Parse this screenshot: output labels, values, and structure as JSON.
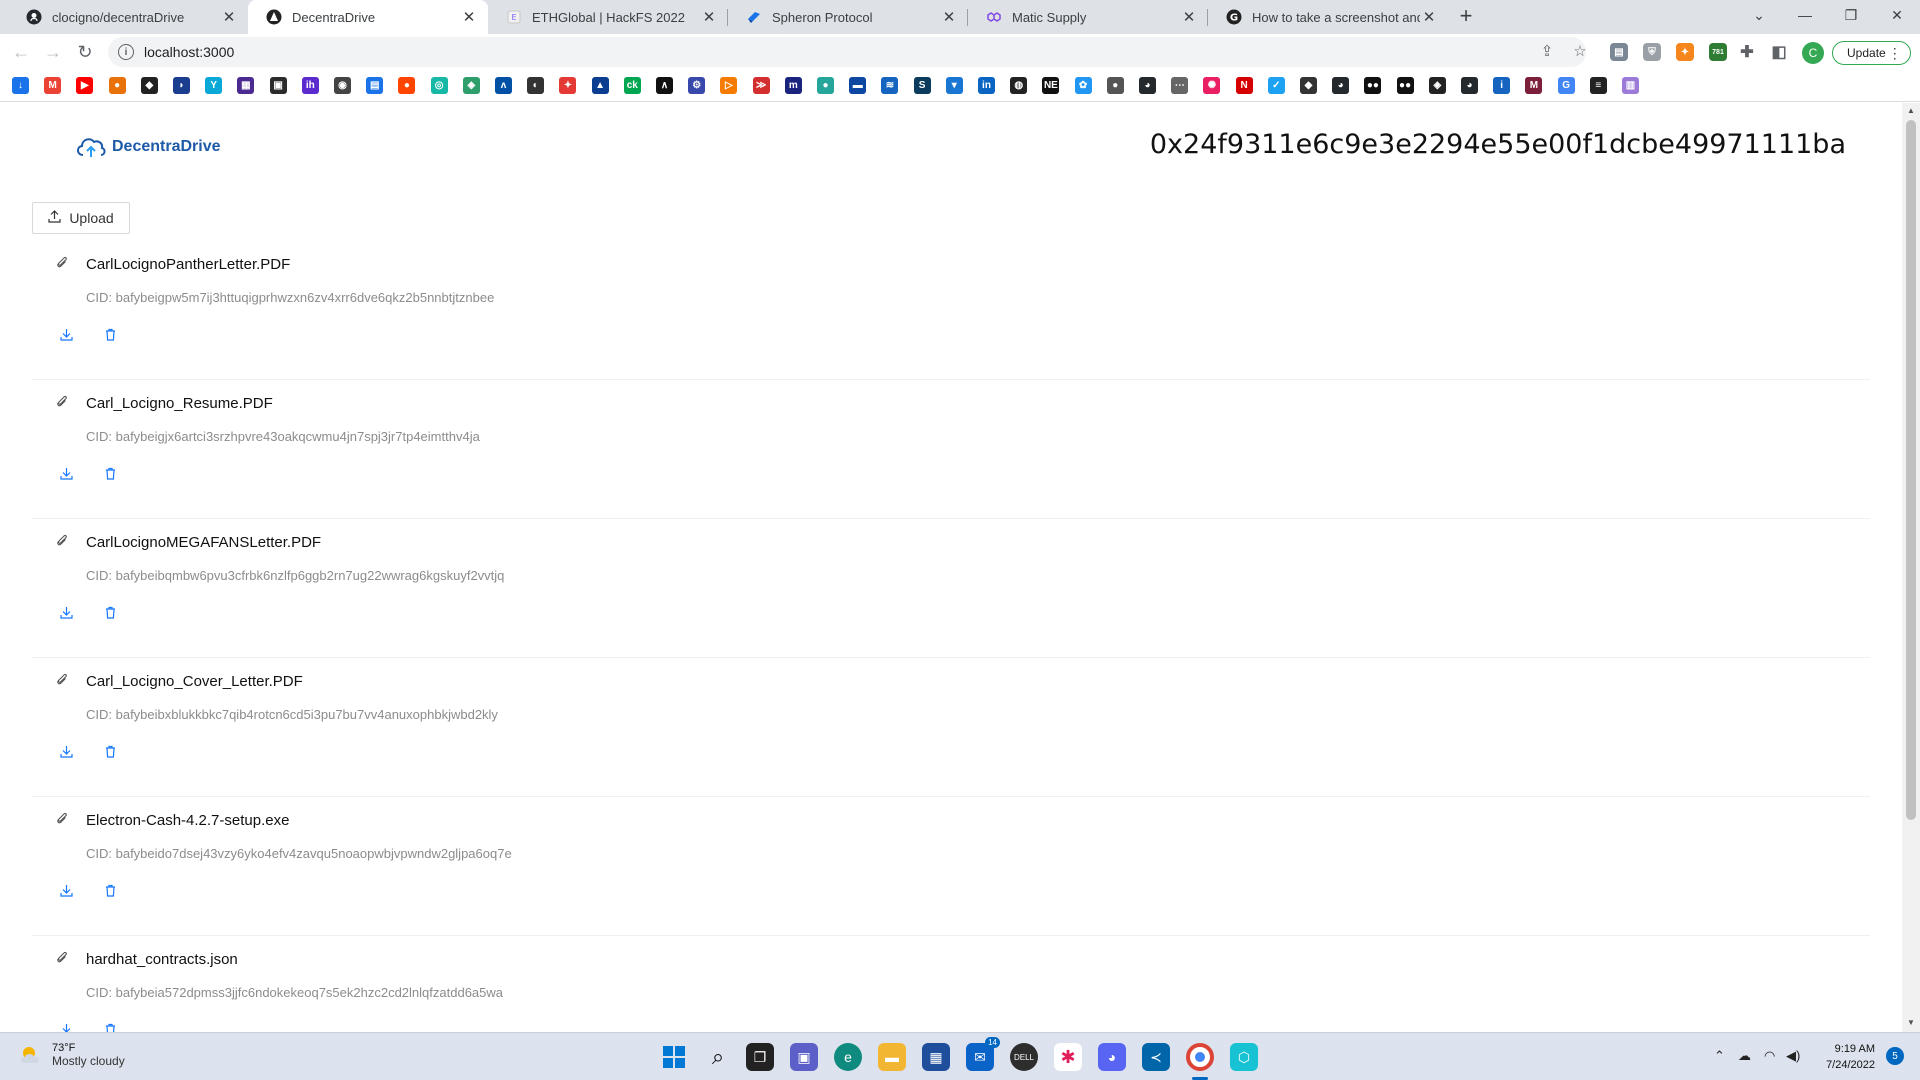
{
  "browser": {
    "tabs": [
      {
        "title": "clocigno/decentraDrive",
        "icon": "github-icon"
      },
      {
        "title": "DecentraDrive",
        "icon": "decentradrive-favicon-icon"
      },
      {
        "title": "ETHGlobal | HackFS 2022",
        "icon": "ethglobal-favicon-icon"
      },
      {
        "title": "Spheron Protocol",
        "icon": "spheron-favicon-icon"
      },
      {
        "title": "Matic Supply",
        "icon": "matic-favicon-icon"
      },
      {
        "title": "How to take a screenshot and sa",
        "icon": "google-favicon-icon"
      }
    ],
    "url": "localhost:3000",
    "update_label": "Update",
    "profile_initial": "C",
    "extension_badge": "781"
  },
  "bookmarks": [
    {
      "icon": "download-bookmark-icon",
      "color": "#1a73e8",
      "glyph": "↓"
    },
    {
      "icon": "gmail-icon",
      "color": "#ea4335",
      "glyph": "M"
    },
    {
      "icon": "youtube-icon",
      "color": "#ff0000",
      "glyph": "▶"
    },
    {
      "icon": "bookmark-icon",
      "color": "#e8710a",
      "glyph": "●"
    },
    {
      "icon": "bookmark-icon",
      "color": "#222222",
      "glyph": "◆"
    },
    {
      "icon": "bookmark-icon",
      "color": "#1a3d8f",
      "glyph": "◗"
    },
    {
      "icon": "bookmark-icon",
      "color": "#0aa8d6",
      "glyph": "Y"
    },
    {
      "icon": "bookmark-icon",
      "color": "#4b2a91",
      "glyph": "▦"
    },
    {
      "icon": "bookmark-icon",
      "color": "#2b2b2b",
      "glyph": "▣"
    },
    {
      "icon": "bookmark-icon",
      "color": "#5b2bcf",
      "glyph": "ih"
    },
    {
      "icon": "bookmark-icon",
      "color": "#444444",
      "glyph": "◉"
    },
    {
      "icon": "bookmark-icon",
      "color": "#1a73e8",
      "glyph": "▤"
    },
    {
      "icon": "reddit-icon",
      "color": "#ff4500",
      "glyph": "●"
    },
    {
      "icon": "bookmark-icon",
      "color": "#17b8a6",
      "glyph": "◎"
    },
    {
      "icon": "bookmark-icon",
      "color": "#2e9e6b",
      "glyph": "◈"
    },
    {
      "icon": "bookmark-icon",
      "color": "#0051a5",
      "glyph": "ʌ"
    },
    {
      "icon": "bookmark-icon",
      "color": "#333333",
      "glyph": "◐"
    },
    {
      "icon": "bookmark-icon",
      "color": "#e53935",
      "glyph": "✦"
    },
    {
      "icon": "bookmark-icon",
      "color": "#0b3d91",
      "glyph": "▲"
    },
    {
      "icon": "bookmark-icon",
      "color": "#00a650",
      "glyph": "ck"
    },
    {
      "icon": "bookmark-icon",
      "color": "#111111",
      "glyph": "∧"
    },
    {
      "icon": "bookmark-icon",
      "color": "#3949ab",
      "glyph": "⚙"
    },
    {
      "icon": "bookmark-icon",
      "color": "#f57c00",
      "glyph": "▷"
    },
    {
      "icon": "bookmark-icon",
      "color": "#d32f2f",
      "glyph": "≫"
    },
    {
      "icon": "bookmark-icon",
      "color": "#1a237e",
      "glyph": "m"
    },
    {
      "icon": "bookmark-icon",
      "color": "#26a69a",
      "glyph": "●"
    },
    {
      "icon": "bookmark-icon",
      "color": "#0d47a1",
      "glyph": "▬"
    },
    {
      "icon": "bookmark-icon",
      "color": "#1565c0",
      "glyph": "≋"
    },
    {
      "icon": "bookmark-icon",
      "color": "#0b3c5d",
      "glyph": "S"
    },
    {
      "icon": "bookmark-icon",
      "color": "#1976d2",
      "glyph": "▾"
    },
    {
      "icon": "linkedin-icon",
      "color": "#0a66c2",
      "glyph": "in"
    },
    {
      "icon": "bookmark-icon",
      "color": "#222222",
      "glyph": "◍"
    },
    {
      "icon": "bookmark-icon",
      "color": "#111111",
      "glyph": "NE"
    },
    {
      "icon": "bookmark-icon",
      "color": "#2196f3",
      "glyph": "✿"
    },
    {
      "icon": "bookmark-icon",
      "color": "#555555",
      "glyph": "●"
    },
    {
      "icon": "github-icon",
      "color": "#24292e",
      "glyph": "◕"
    },
    {
      "icon": "bookmark-icon",
      "color": "#666666",
      "glyph": "⋯"
    },
    {
      "icon": "bookmark-icon",
      "color": "#e91e63",
      "glyph": "✺"
    },
    {
      "icon": "bookmark-icon",
      "color": "#d50000",
      "glyph": "N"
    },
    {
      "icon": "twitter-icon",
      "color": "#1da1f2",
      "glyph": "✓"
    },
    {
      "icon": "bookmark-icon",
      "color": "#333333",
      "glyph": "◆"
    },
    {
      "icon": "github-icon",
      "color": "#24292e",
      "glyph": "◕"
    },
    {
      "icon": "bookmark-icon",
      "color": "#111111",
      "glyph": "●●"
    },
    {
      "icon": "bookmark-icon",
      "color": "#111111",
      "glyph": "●●"
    },
    {
      "icon": "bookmark-icon",
      "color": "#222222",
      "glyph": "◈"
    },
    {
      "icon": "github-icon",
      "color": "#24292e",
      "glyph": "◕"
    },
    {
      "icon": "bookmark-icon",
      "color": "#1565c0",
      "glyph": "i"
    },
    {
      "icon": "bookmark-icon",
      "color": "#7b1f3a",
      "glyph": "M"
    },
    {
      "icon": "google-icon",
      "color": "#4285f4",
      "glyph": "G"
    },
    {
      "icon": "bookmark-icon",
      "color": "#222222",
      "glyph": "≡"
    },
    {
      "icon": "bookmark-icon",
      "color": "#9c7bd8",
      "glyph": "▥"
    }
  ],
  "app": {
    "logo_text": "DecentraDrive",
    "wallet_address": "0x24f9311e6c9e3e2294e55e00f1dcbe49971111ba",
    "upload_label": "Upload",
    "files": [
      {
        "name": "CarlLocignoPantherLetter.PDF",
        "cid": "CID: bafybeigpw5m7ij3httuqigprhwzxn6zv4xrr6dve6qkz2b5nnbtjtznbee"
      },
      {
        "name": "Carl_Locigno_Resume.PDF",
        "cid": "CID: bafybeigjx6artci3srzhpvre43oakqcwmu4jn7spj3jr7tp4eimtthv4ja"
      },
      {
        "name": "CarlLocignoMEGAFANSLetter.PDF",
        "cid": "CID: bafybeibqmbw6pvu3cfrbk6nzlfp6ggb2rn7ug22wwrag6kgskuyf2vvtjq"
      },
      {
        "name": "Carl_Locigno_Cover_Letter.PDF",
        "cid": "CID: bafybeibxblukkbkc7qib4rotcn6cd5i3pu7bu7vv4anuxophbkjwbd2kly"
      },
      {
        "name": "Electron-Cash-4.2.7-setup.exe",
        "cid": "CID: bafybeido7dsej43vzy6yko4efv4zavqu5noaopwbjvpwndw2gljpa6oq7e"
      },
      {
        "name": "hardhat_contracts.json",
        "cid": "CID: bafybeia572dpmss3jjfc6ndokekeoq7s5ek2hzc2cd2lnlqfzatdd6a5wa"
      }
    ]
  },
  "taskbar": {
    "weather_temp": "73°F",
    "weather_desc": "Mostly cloudy",
    "time": "9:19 AM",
    "date": "7/24/2022",
    "mail_badge": "14",
    "notification_count": "5"
  }
}
